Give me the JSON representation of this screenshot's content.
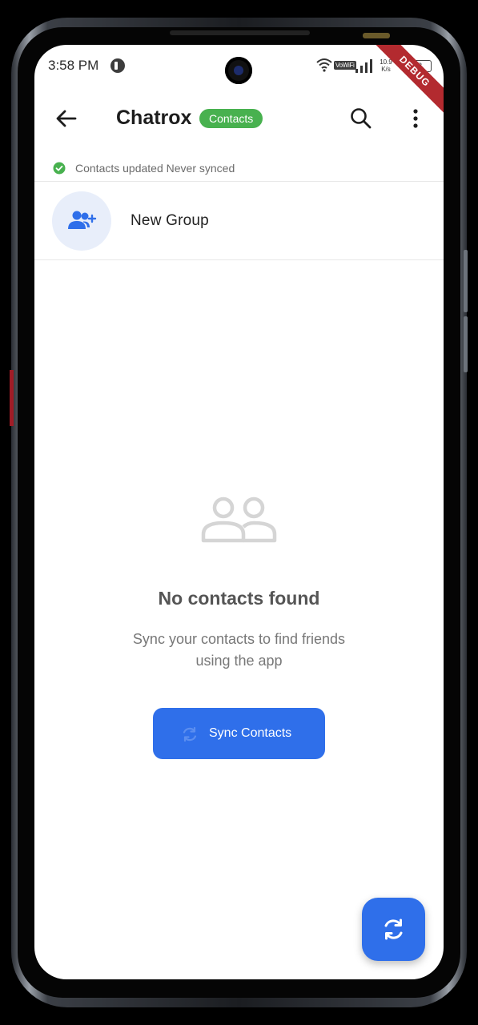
{
  "status_bar": {
    "time": "3:58 PM",
    "vowifi": "VoWiFi",
    "net_speed_value": "10.9",
    "net_speed_unit": "K/s",
    "battery_level": "52",
    "debug_label": "DEBUG"
  },
  "app_bar": {
    "title": "Chatrox",
    "badge": "Contacts",
    "icons": [
      "arrow-back-icon",
      "search-icon",
      "more-vert-icon"
    ]
  },
  "sync_status": {
    "text": "Contacts updated Never synced",
    "icon": "check-circle-icon"
  },
  "new_group": {
    "label": "New Group",
    "icon": "group-add-icon"
  },
  "empty_state": {
    "icon": "people-outline-icon",
    "title": "No contacts found",
    "subtitle": "Sync your contacts to find friends using the app"
  },
  "sync_button": {
    "label": "Sync Contacts",
    "icon": "sync-icon"
  },
  "fab": {
    "icon": "sync-icon"
  },
  "colors": {
    "primary": "#2f6fea",
    "badge_green": "#48b14f",
    "debug_red": "#b32a2f"
  }
}
